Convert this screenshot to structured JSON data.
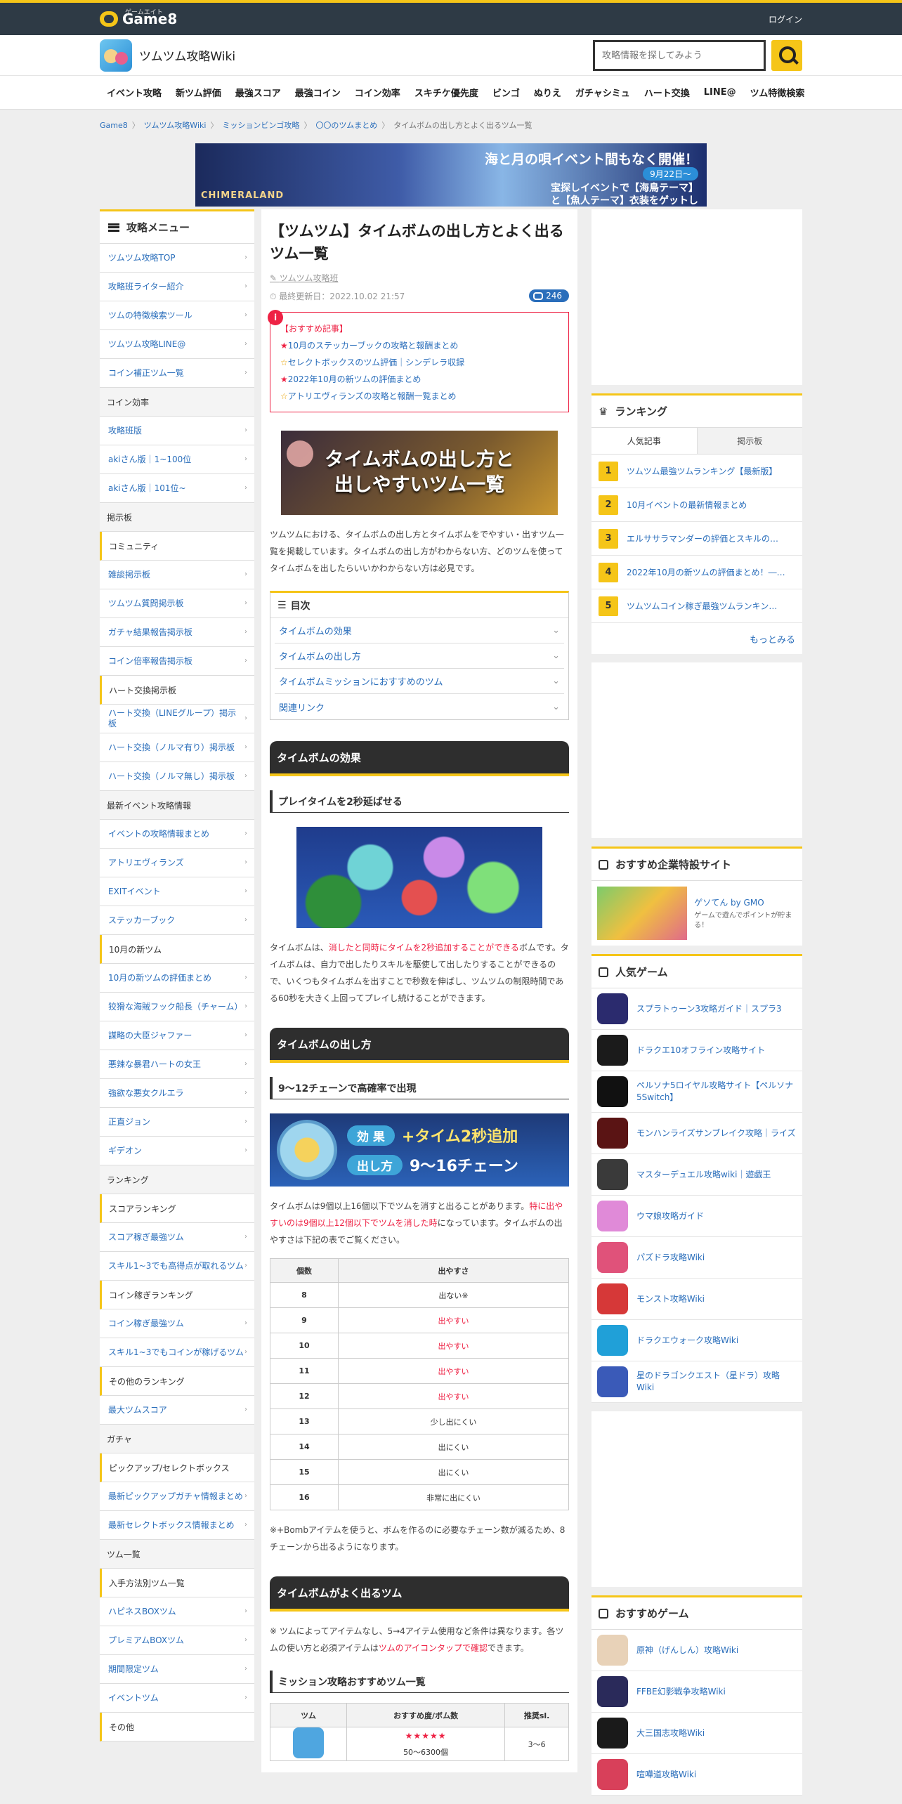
{
  "topbar": {
    "logo_small": "ゲームエイト",
    "logo": "Game8",
    "login": "ログイン"
  },
  "header": {
    "site_name": "ツムツム攻略Wiki",
    "search_placeholder": "攻略情報を探してみよう"
  },
  "gnav": [
    "イベント攻略",
    "新ツム評価",
    "最強スコア",
    "最強コイン",
    "コイン効率",
    "スキチケ優先度",
    "ビンゴ",
    "ぬりえ",
    "ガチャシミュ",
    "ハート交換",
    "LINE@",
    "ツム特徴検索"
  ],
  "breadcrumb": [
    "Game8",
    "ツムツム攻略Wiki",
    "ミッションビンゴ攻略",
    "〇〇のツムまとめ",
    "タイムボムの出し方とよく出るツム一覧"
  ],
  "banner": {
    "logo": "CHIMERALAND",
    "headline": "海と月の唄イベント間もなく開催！",
    "date": "9月22日〜",
    "body": "宝探しイベントで【海鳥テーマ】と【魚人テーマ】衣装をゲットしよう"
  },
  "sidebar": {
    "title": "攻略メニュー",
    "items": [
      {
        "type": "link",
        "label": "ツムツム攻略TOP"
      },
      {
        "type": "link",
        "label": "攻略班ライター紹介"
      },
      {
        "type": "link",
        "label": "ツムの特徴検索ツール"
      },
      {
        "type": "link",
        "label": "ツムツム攻略LINE@"
      },
      {
        "type": "link",
        "label": "コイン補正ツム一覧"
      },
      {
        "type": "head",
        "label": "コイン効率"
      },
      {
        "type": "link",
        "label": "攻略班版"
      },
      {
        "type": "link",
        "label": "akiさん版｜1~100位"
      },
      {
        "type": "link",
        "label": "akiさん版｜101位~"
      },
      {
        "type": "head",
        "label": "掲示板"
      },
      {
        "type": "sub",
        "label": "コミュニティ"
      },
      {
        "type": "link",
        "label": "雑談掲示板"
      },
      {
        "type": "link",
        "label": "ツムツム質問掲示板"
      },
      {
        "type": "link",
        "label": "ガチャ結果報告掲示板"
      },
      {
        "type": "link",
        "label": "コイン倍率報告掲示板"
      },
      {
        "type": "sub",
        "label": "ハート交換掲示板"
      },
      {
        "type": "link",
        "label": "ハート交換（LINEグループ）掲示板"
      },
      {
        "type": "link",
        "label": "ハート交換（ノルマ有り）掲示板"
      },
      {
        "type": "link",
        "label": "ハート交換（ノルマ無し）掲示板"
      },
      {
        "type": "head",
        "label": "最新イベント攻略情報"
      },
      {
        "type": "link",
        "label": "イベントの攻略情報まとめ"
      },
      {
        "type": "link",
        "label": "アトリエヴィランズ"
      },
      {
        "type": "link",
        "label": "EXITイベント"
      },
      {
        "type": "link",
        "label": "ステッカーブック"
      },
      {
        "type": "sub",
        "label": "10月の新ツム"
      },
      {
        "type": "link",
        "label": "10月の新ツムの評価まとめ"
      },
      {
        "type": "link",
        "label": "狡猾な海賊フック船長（チャーム）"
      },
      {
        "type": "link",
        "label": "謀略の大臣ジャファー"
      },
      {
        "type": "link",
        "label": "悪辣な暴君ハートの女王"
      },
      {
        "type": "link",
        "label": "強欲な悪女クルエラ"
      },
      {
        "type": "link",
        "label": "正直ジョン"
      },
      {
        "type": "link",
        "label": "ギデオン"
      },
      {
        "type": "head",
        "label": "ランキング"
      },
      {
        "type": "sub",
        "label": "スコアランキング"
      },
      {
        "type": "link",
        "label": "スコア稼ぎ最強ツム"
      },
      {
        "type": "link",
        "label": "スキル1~3でも高得点が取れるツム"
      },
      {
        "type": "sub",
        "label": "コイン稼ぎランキング"
      },
      {
        "type": "link",
        "label": "コイン稼ぎ最強ツム"
      },
      {
        "type": "link",
        "label": "スキル1~3でもコインが稼げるツム"
      },
      {
        "type": "sub",
        "label": "その他のランキング"
      },
      {
        "type": "link",
        "label": "最大ツムスコア"
      },
      {
        "type": "head",
        "label": "ガチャ"
      },
      {
        "type": "sub",
        "label": "ピックアップ/セレクトボックス"
      },
      {
        "type": "link",
        "label": "最新ピックアップガチャ情報まとめ"
      },
      {
        "type": "link",
        "label": "最新セレクトボックス情報まとめ"
      },
      {
        "type": "head",
        "label": "ツム一覧"
      },
      {
        "type": "sub",
        "label": "入手方法別ツム一覧"
      },
      {
        "type": "link",
        "label": "ハピネスBOXツム"
      },
      {
        "type": "link",
        "label": "プレミアムBOXツム"
      },
      {
        "type": "link",
        "label": "期間限定ツム"
      },
      {
        "type": "link",
        "label": "イベントツム"
      },
      {
        "type": "sub",
        "label": "その他"
      }
    ]
  },
  "article": {
    "title": "【ツムツム】タイムボムの出し方とよく出るツム一覧",
    "author": "ツムツム攻略班",
    "updated": "最終更新日：2022.10.02 21:57",
    "comments": "246",
    "recommended_head": "【おすすめ記事】",
    "recommended": [
      {
        "mark": "★",
        "text": "10月のステッカーブックの攻略と報酬まとめ"
      },
      {
        "mark": "☆",
        "text": "セレクトボックスのツム評価｜シンデレラ収録"
      },
      {
        "mark": "★",
        "text": "2022年10月の新ツムの評価まとめ"
      },
      {
        "mark": "☆",
        "text": "アトリエヴィランズの攻略と報酬一覧まとめ"
      }
    ],
    "hero_line1": "タイムボムの出し方と",
    "hero_line2": "出しやすいツム一覧",
    "intro": "ツムツムにおける、タイムボムの出し方とタイムボムをでやすい・出すツム一覧を掲載しています。タイムボムの出し方がわからない方、どのツムを使ってタイムボムを出したらいいかわからない方は必見です。",
    "toc_title": "目次",
    "toc": [
      "タイムボムの効果",
      "タイムボムの出し方",
      "タイムボムミッションにおすすめのツム",
      "関連リンク"
    ],
    "h2_effect": "タイムボムの効果",
    "h3_effect": "プレイタイムを2秒延ばせる",
    "effect_pre": "タイムボムは、",
    "effect_red": "消したと同時にタイムを2秒追加することができる",
    "effect_post": "ボムです。タイムボムは、自力で出したりスキルを駆使して出したりすることができるので、いくつもタイムボムを出すことで秒数を伸ばし、ツムツムの制限時間である60秒を大きく上回ってプレイし続けることができます。",
    "h2_how": "タイムボムの出し方",
    "h3_how": "9～12チェーンで高確率で出現",
    "effect_label": "効 果",
    "effect_value": "+タイム2秒追加",
    "how_label": "出し方",
    "how_value": "9〜16チェーン",
    "how_pre": "タイムボムは9個以上16個以下でツムを消すと出ることがあります。",
    "how_red": "特に出やすいのは9個以上12個以下でツムを消した時",
    "how_post": "になっています。タイムボムの出やすさは下記の表でご覧ください。",
    "table_headers": [
      "個数",
      "出やすさ"
    ],
    "table_rows": [
      {
        "n": "8",
        "v": "出ない※",
        "red": false
      },
      {
        "n": "9",
        "v": "出やすい",
        "red": true
      },
      {
        "n": "10",
        "v": "出やすい",
        "red": true
      },
      {
        "n": "11",
        "v": "出やすい",
        "red": true
      },
      {
        "n": "12",
        "v": "出やすい",
        "red": true
      },
      {
        "n": "13",
        "v": "少し出にくい",
        "red": false
      },
      {
        "n": "14",
        "v": "出にくい",
        "red": false
      },
      {
        "n": "15",
        "v": "出にくい",
        "red": false
      },
      {
        "n": "16",
        "v": "非常に出にくい",
        "red": false
      }
    ],
    "note": "※+Bombアイテムを使うと、ボムを作るのに必要なチェーン数が減るため、8チェーンから出るようになります。",
    "h2_tsum": "タイムボムがよく出るツム",
    "tsum_pre": "※ ツムによってアイテムなし、5→4アイテム使用など条件は異なります。各ツムの使い方と必須アイテムは",
    "tsum_link": "ツムのアイコンタップで確認",
    "tsum_post": "できます。",
    "h3_mission": "ミッション攻略おすすめツム一覧",
    "mission_headers": [
      "ツム",
      "おすすめ度/ボム数",
      "推奨sl."
    ],
    "mission_row": {
      "stars": "★★★★★",
      "count": "50～6300個",
      "sl": "3～6"
    }
  },
  "right": {
    "ranking_title": "ランキング",
    "tab_active": "人気記事",
    "tab_inactive": "掲示板",
    "ranking": [
      {
        "n": "1",
        "text": "ツムツム最強ツムランキング【最新版】"
      },
      {
        "n": "2",
        "text": "10月イベントの最新情報まとめ"
      },
      {
        "n": "3",
        "text": "エルササラマンダーの評価とスキルの…"
      },
      {
        "n": "4",
        "text": "2022年10月の新ツムの評価まとめ！―…"
      },
      {
        "n": "5",
        "text": "ツムツムコイン稼ぎ最強ツムランキン…"
      }
    ],
    "more": "もっとみる",
    "sponsor_title": "おすすめ企業特設サイト",
    "sponsor_name": "ゲソてん by GMO",
    "sponsor_desc": "ゲームで遊んでポイントが貯まる！",
    "popular_title": "人気ゲーム",
    "popular": [
      {
        "text": "スプラトゥーン3攻略ガイド｜スプラ3",
        "color": "#2b2b6e"
      },
      {
        "text": "ドラクエ10オフライン攻略サイト",
        "color": "#1b1b1b"
      },
      {
        "text": "ペルソナ5ロイヤル攻略サイト【ペルソナ5Switch】",
        "color": "#111111"
      },
      {
        "text": "モンハンライズサンブレイク攻略｜ライズ",
        "color": "#5a1414"
      },
      {
        "text": "マスターデュエル攻略wiki｜遊戯王",
        "color": "#3a3a3a"
      },
      {
        "text": "ウマ娘攻略ガイド",
        "color": "#e08ad8"
      },
      {
        "text": "パズドラ攻略Wiki",
        "color": "#e0527a"
      },
      {
        "text": "モンスト攻略Wiki",
        "color": "#d63838"
      },
      {
        "text": "ドラクエウォーク攻略Wiki",
        "color": "#20a0d8"
      },
      {
        "text": "星のドラゴンクエスト（星ドラ）攻略Wiki",
        "color": "#3a5ab8"
      }
    ],
    "recommend_title": "おすすめゲーム",
    "recommend": [
      {
        "text": "原神（げんしん）攻略Wiki",
        "color": "#e8d2b8"
      },
      {
        "text": "FFBE幻影戦争攻略Wiki",
        "color": "#2a2a5a"
      },
      {
        "text": "大三国志攻略Wiki",
        "color": "#1a1a1a"
      },
      {
        "text": "喧嘩道攻略Wiki",
        "color": "#d8405a"
      }
    ]
  }
}
